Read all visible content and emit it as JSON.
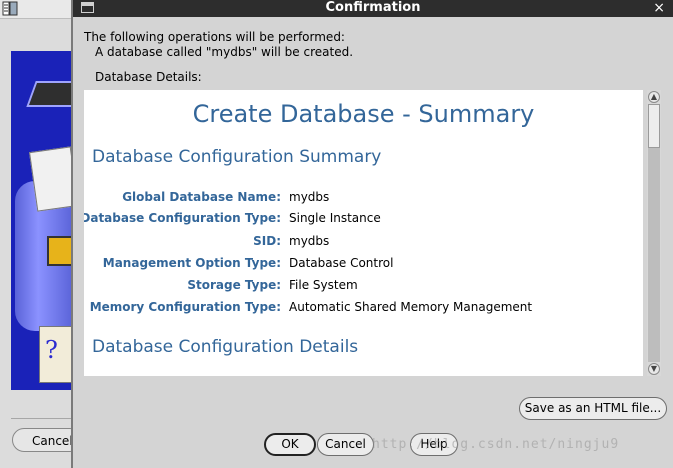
{
  "background_window": {
    "cancel_label": "Cancel"
  },
  "dialog": {
    "title": "Confirmation",
    "close_glyph": "×",
    "operations_intro": "The following operations will be performed:",
    "operation_item": "A database called \"mydbs\" will be created.",
    "details_label": "Database Details:"
  },
  "summary": {
    "title": "Create Database - Summary",
    "section1_heading": "Database Configuration Summary",
    "rows": [
      {
        "label": "Global Database Name:",
        "value": "mydbs"
      },
      {
        "label": "Database Configuration Type:",
        "value": "Single Instance"
      },
      {
        "label": "SID:",
        "value": "mydbs"
      },
      {
        "label": "Management Option Type:",
        "value": "Database Control"
      },
      {
        "label": "Storage Type:",
        "value": "File System"
      },
      {
        "label": "Memory Configuration Type:",
        "value": "Automatic Shared Memory Management"
      }
    ],
    "section2_heading": "Database Configuration Details"
  },
  "buttons": {
    "save_html": "Save as an HTML file...",
    "ok": "OK",
    "cancel": "Cancel",
    "help": "Help"
  },
  "watermark": "http://blog.csdn.net/ningju9",
  "colors": {
    "heading_blue": "#336699",
    "titlebar": "#2d2d2d"
  }
}
